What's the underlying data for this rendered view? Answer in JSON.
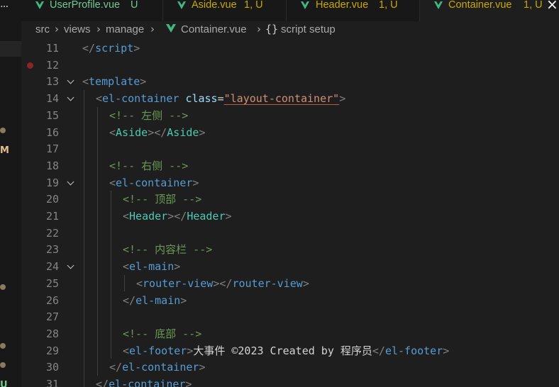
{
  "tabs": [
    {
      "name": "UserProfile.vue",
      "status": "U",
      "kind": "new"
    },
    {
      "name": "Aside.vue",
      "status": "1, U",
      "kind": "warn"
    },
    {
      "name": "Header.vue",
      "status": "1, U",
      "kind": "warn"
    },
    {
      "name": "Container.vue",
      "status": "1, U",
      "kind": "warn",
      "active": true
    }
  ],
  "activity": {
    "more": "...",
    "m_badge": "M",
    "u_badge": "U"
  },
  "breadcrumb": {
    "seg1": "src",
    "seg2": "views",
    "seg3": "manage",
    "file": "Container.vue",
    "braces": "{}",
    "symbol": "script setup"
  },
  "lines": [
    {
      "n": "11",
      "parts": [
        [
          "</",
          "t-bracket"
        ],
        [
          "script",
          "t-tag"
        ],
        [
          ">",
          "t-bracket"
        ]
      ],
      "indent": 0
    },
    {
      "n": "12",
      "parts": [],
      "indent": 0,
      "breakpoint": true
    },
    {
      "n": "13",
      "parts": [
        [
          "<",
          "t-bracket"
        ],
        [
          "template",
          "t-tag"
        ],
        [
          ">",
          "t-bracket"
        ]
      ],
      "indent": 0,
      "fold": true
    },
    {
      "n": "14",
      "parts": [
        [
          "<",
          "t-bracket"
        ],
        [
          "el-container",
          "t-tag"
        ],
        [
          " ",
          "t-text"
        ],
        [
          "class",
          "t-attr"
        ],
        [
          "=",
          "t-text"
        ],
        [
          "\"",
          "t-str"
        ],
        [
          "layout-container",
          "t-str"
        ],
        [
          "\"",
          "t-str"
        ],
        [
          ">",
          "t-bracket"
        ]
      ],
      "indent": 1,
      "fold": true
    },
    {
      "n": "15",
      "parts": [
        [
          "<!-- 左侧 -->",
          "t-comment"
        ]
      ],
      "indent": 2
    },
    {
      "n": "16",
      "parts": [
        [
          "<",
          "t-bracket"
        ],
        [
          "Aside",
          "t-comp"
        ],
        [
          "></",
          "t-bracket"
        ],
        [
          "Aside",
          "t-comp"
        ],
        [
          ">",
          "t-bracket"
        ]
      ],
      "indent": 2
    },
    {
      "n": "17",
      "parts": [],
      "indent": 0
    },
    {
      "n": "18",
      "parts": [
        [
          "<!-- 右侧 -->",
          "t-comment"
        ]
      ],
      "indent": 2
    },
    {
      "n": "19",
      "parts": [
        [
          "<",
          "t-bracket"
        ],
        [
          "el-container",
          "t-tag"
        ],
        [
          ">",
          "t-bracket"
        ]
      ],
      "indent": 2,
      "fold": true
    },
    {
      "n": "20",
      "parts": [
        [
          "<!-- 顶部 -->",
          "t-comment"
        ]
      ],
      "indent": 3
    },
    {
      "n": "21",
      "parts": [
        [
          "<",
          "t-bracket"
        ],
        [
          "Header",
          "t-comp"
        ],
        [
          "></",
          "t-bracket"
        ],
        [
          "Header",
          "t-comp"
        ],
        [
          ">",
          "t-bracket"
        ]
      ],
      "indent": 3
    },
    {
      "n": "22",
      "parts": [],
      "indent": 0
    },
    {
      "n": "23",
      "parts": [
        [
          "<!-- 内容栏 -->",
          "t-comment"
        ]
      ],
      "indent": 3
    },
    {
      "n": "24",
      "parts": [
        [
          "<",
          "t-bracket"
        ],
        [
          "el-main",
          "t-tag"
        ],
        [
          ">",
          "t-bracket"
        ]
      ],
      "indent": 3,
      "fold": true
    },
    {
      "n": "25",
      "parts": [
        [
          "<",
          "t-bracket"
        ],
        [
          "router-view",
          "t-tag"
        ],
        [
          "></",
          "t-bracket"
        ],
        [
          "router-view",
          "t-tag"
        ],
        [
          ">",
          "t-bracket"
        ]
      ],
      "indent": 4
    },
    {
      "n": "26",
      "parts": [
        [
          "</",
          "t-bracket"
        ],
        [
          "el-main",
          "t-tag"
        ],
        [
          ">",
          "t-bracket"
        ]
      ],
      "indent": 3
    },
    {
      "n": "27",
      "parts": [],
      "indent": 0
    },
    {
      "n": "28",
      "parts": [
        [
          "<!-- 底部 -->",
          "t-comment"
        ]
      ],
      "indent": 3
    },
    {
      "n": "29",
      "parts": [
        [
          "<",
          "t-bracket"
        ],
        [
          "el-footer",
          "t-tag"
        ],
        [
          ">",
          "t-bracket"
        ],
        [
          "大事件 ©2023 Created by 程序员",
          "t-text"
        ],
        [
          "</",
          "t-bracket"
        ],
        [
          "el-footer",
          "t-tag"
        ],
        [
          ">",
          "t-bracket"
        ]
      ],
      "indent": 3
    },
    {
      "n": "30",
      "parts": [
        [
          "</",
          "t-bracket"
        ],
        [
          "el-container",
          "t-tag"
        ],
        [
          ">",
          "t-bracket"
        ]
      ],
      "indent": 2
    },
    {
      "n": "31",
      "parts": [
        [
          "</",
          "t-bracket"
        ],
        [
          "el-container",
          "t-tag"
        ],
        [
          ">",
          "t-bracket"
        ]
      ],
      "indent": 1
    }
  ]
}
